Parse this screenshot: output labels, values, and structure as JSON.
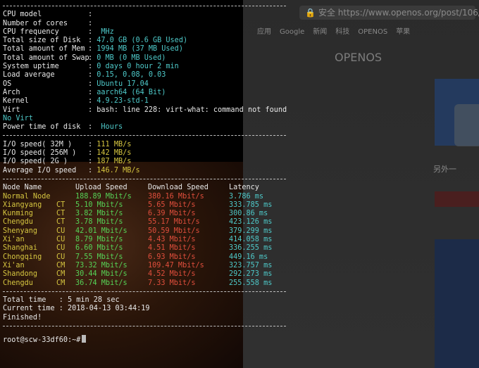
{
  "background": {
    "address": {
      "secure": "安全",
      "url": "https://www.openos.org/post/106/"
    },
    "bookmarks": [
      "应用",
      "Google",
      "新闻",
      "科技",
      "OPENOS",
      "苹果"
    ],
    "site_title": "OPENOS",
    "side_text": "另外一"
  },
  "sysinfo": [
    {
      "key": "CPU model",
      "sep": ":",
      "value": "",
      "color": "c"
    },
    {
      "key": "Number of cores",
      "sep": ":",
      "value": "",
      "color": "c"
    },
    {
      "key": "CPU frequency",
      "sep": ":",
      "value": " MHz",
      "color": "c"
    },
    {
      "key": "Total size of Disk",
      "sep": ":",
      "value": "47.0 GB (0.6 GB Used)",
      "color": "c"
    },
    {
      "key": "Total amount of Mem",
      "sep": ":",
      "value": "1994 MB (37 MB Used)",
      "color": "c"
    },
    {
      "key": "Total amount of Swap",
      "sep": ":",
      "value": "0 MB (0 MB Used)",
      "color": "c"
    },
    {
      "key": "System uptime",
      "sep": ":",
      "value": "0 days 0 hour 2 min",
      "color": "c"
    },
    {
      "key": "Load average",
      "sep": ":",
      "value": "0.15, 0.08, 0.03",
      "color": "c"
    },
    {
      "key": "OS",
      "sep": ":",
      "value": "Ubuntu 17.04",
      "color": "c"
    },
    {
      "key": "Arch",
      "sep": ":",
      "value": "aarch64 (64 Bit)",
      "color": "c"
    },
    {
      "key": "Kernel",
      "sep": ":",
      "value": "4.9.23-std-1",
      "color": "c"
    },
    {
      "key": "Virt",
      "sep": ":",
      "value": "bash: line 228: virt-what: command not found",
      "color": "w"
    }
  ],
  "virt_extra": "No Virt",
  "power_time": {
    "key": "Power time of disk",
    "sep": ":",
    "value": "Hours"
  },
  "io": [
    {
      "key": "I/O speed( 32M )",
      "value": "111 MB/s"
    },
    {
      "key": "I/O speed( 256M )",
      "value": "142 MB/s"
    },
    {
      "key": "I/O speed( 2G )",
      "value": "187 MB/s"
    },
    {
      "key": "Average I/O speed",
      "value": "146.7 MB/s"
    }
  ],
  "net_header": {
    "node": "Node Name",
    "upload": "Upload Speed",
    "download": "Download Speed",
    "latency": "Latency"
  },
  "net_rows": [
    {
      "city": "Normal Node",
      "isp": "",
      "upload": "188.89 Mbit/s",
      "download": "380.16 Mbit/s",
      "latency": "3.786 ms"
    },
    {
      "city": "Xiangyang",
      "isp": "CT",
      "upload": "5.10 Mbit/s",
      "download": "5.65 Mbit/s",
      "latency": "333.785 ms"
    },
    {
      "city": "Kunming",
      "isp": "CT",
      "upload": "3.82 Mbit/s",
      "download": "6.39 Mbit/s",
      "latency": "300.86 ms"
    },
    {
      "city": "Chengdu",
      "isp": "CT",
      "upload": "3.78 Mbit/s",
      "download": "55.17 Mbit/s",
      "latency": "423.126 ms"
    },
    {
      "city": "Shenyang",
      "isp": "CU",
      "upload": "42.01 Mbit/s",
      "download": "50.59 Mbit/s",
      "latency": "379.299 ms"
    },
    {
      "city": "Xi'an",
      "isp": "CU",
      "upload": "8.79 Mbit/s",
      "download": "4.43 Mbit/s",
      "latency": "414.058 ms"
    },
    {
      "city": "Shanghai",
      "isp": "CU",
      "upload": "6.60 Mbit/s",
      "download": "4.51 Mbit/s",
      "latency": "336.255 ms"
    },
    {
      "city": "Chongqing",
      "isp": "CU",
      "upload": "7.55 Mbit/s",
      "download": "6.93 Mbit/s",
      "latency": "449.16 ms"
    },
    {
      "city": "Xi'an",
      "isp": "CM",
      "upload": "73.32 Mbit/s",
      "download": "109.47 Mbit/s",
      "latency": "323.757 ms"
    },
    {
      "city": "Shandong",
      "isp": "CM",
      "upload": "30.44 Mbit/s",
      "download": "4.52 Mbit/s",
      "latency": "292.273 ms"
    },
    {
      "city": "Chengdu",
      "isp": "CM",
      "upload": "36.74 Mbit/s",
      "download": "7.33 Mbit/s",
      "latency": "255.558 ms"
    }
  ],
  "summary": {
    "total_time": "Total time   : 5 min 28 sec",
    "current_time": "Current time : 2018-04-13 03:44:19",
    "finished": "Finished!"
  },
  "prompt": "root@scw-33df60:~#",
  "colors": {
    "cyan": "#4ec9c9",
    "yellow": "#d6c640",
    "green": "#56d356",
    "red": "#e04e3c"
  }
}
